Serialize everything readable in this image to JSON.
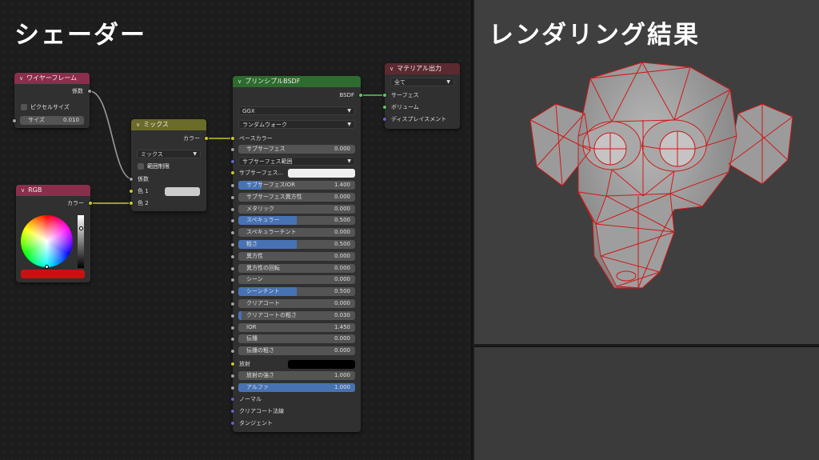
{
  "shader_title": "シェーダー",
  "render_title": "レンダリング結果",
  "wireframe_node": {
    "header": "ワイヤーフレーム",
    "output": "係数",
    "pixel_size_label": "ピクセルサイズ",
    "size_label": "サイズ",
    "size_value": "0.010"
  },
  "rgb_node": {
    "header": "RGB",
    "output": "カラー",
    "color": "#c81212"
  },
  "mix_node": {
    "header": "ミックス",
    "output": "カラー",
    "mode": "ミックス",
    "clamp_label": "範囲制限",
    "factor_label": "係数",
    "color1_label": "色 1",
    "color2_label": "色 2"
  },
  "bsdf_node": {
    "header": "プリンシプルBSDF",
    "output": "BSDF",
    "distribution": "GGX",
    "subsurface_method": "ランダムウォーク",
    "base_color_label": "ベースカラー",
    "subsurface_label": "サブサーフェス",
    "subsurface_value": "0.000",
    "subsurface_radius_label": "サブサーフェス範囲",
    "subsurface_color_label": "サブサーフェス...",
    "params": [
      {
        "label": "サブサーフェスIOR",
        "value": "1.400",
        "fill": 0.2
      },
      {
        "label": "サブサーフェス異方性",
        "value": "0.000",
        "fill": 0
      },
      {
        "label": "メタリック",
        "value": "0.000",
        "fill": 0
      },
      {
        "label": "スペキュラー",
        "value": "0.500",
        "fill": 0.5
      },
      {
        "label": "スペキュラーチント",
        "value": "0.000",
        "fill": 0
      },
      {
        "label": "粗さ",
        "value": "0.500",
        "fill": 0.5
      },
      {
        "label": "異方性",
        "value": "0.000",
        "fill": 0
      },
      {
        "label": "異方性の回転",
        "value": "0.000",
        "fill": 0
      },
      {
        "label": "シーン",
        "value": "0.000",
        "fill": 0
      },
      {
        "label": "シーンチント",
        "value": "0.500",
        "fill": 0.5
      },
      {
        "label": "クリアコート",
        "value": "0.000",
        "fill": 0
      },
      {
        "label": "クリアコートの粗さ",
        "value": "0.030",
        "fill": 0.03
      },
      {
        "label": "IOR",
        "value": "1.450",
        "fill": 0
      },
      {
        "label": "伝播",
        "value": "0.000",
        "fill": 0
      },
      {
        "label": "伝播の粗さ",
        "value": "0.000",
        "fill": 0
      }
    ],
    "emission_label": "放射",
    "emission_strength_label": "放射の強さ",
    "emission_strength_value": "1.000",
    "alpha_label": "アルファ",
    "alpha_value": "1.000",
    "normal_label": "ノーマル",
    "clearcoat_normal_label": "クリアコート法線",
    "tangent_label": "タンジェント"
  },
  "output_node": {
    "header": "マテリアル出力",
    "target": "全て",
    "surface_label": "サーフェス",
    "volume_label": "ボリューム",
    "displacement_label": "ディスプレイスメント"
  },
  "colors": {
    "wireframe_header": "#8a2e4c",
    "rgb_header": "#8a2e4c",
    "mix_header": "#6b6b2a",
    "bsdf_header": "#2e6b2e",
    "output_header": "#5a2a30",
    "wire": "#d01818"
  }
}
